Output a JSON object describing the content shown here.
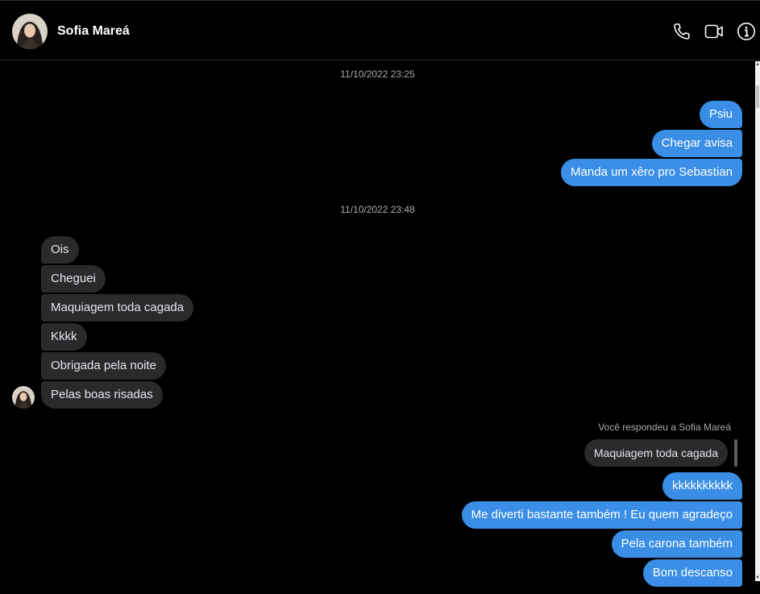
{
  "contact": {
    "name": "Sofia Mareá"
  },
  "header_icons": [
    "phone-icon",
    "video-camera-icon",
    "info-icon"
  ],
  "timestamps": [
    "11/10/2022 23:25",
    "11/10/2022 23:48"
  ],
  "messages": {
    "group1_out": [
      "Psiu",
      "Chegar avisa",
      "Manda um xêro pro Sebastian"
    ],
    "group2_in": [
      "Ois",
      "Cheguei",
      "Maquiagem toda cagada",
      "Kkkk",
      "Obrigada pela noite",
      "Pelas boas risadas"
    ],
    "reply": {
      "note": "Você respondeu a Sofia Mareá",
      "quoted": "Maquiagem toda cagada"
    },
    "group3_out": [
      "kkkkkkkkkk",
      "Me diverti bastante também ! Eu quem agradeço",
      "Pela carona também",
      "Bom descanso"
    ]
  },
  "colors": {
    "outgoing_bubble": "#3a8ee6",
    "incoming_bubble": "#2a2a2c",
    "background": "#000000"
  }
}
